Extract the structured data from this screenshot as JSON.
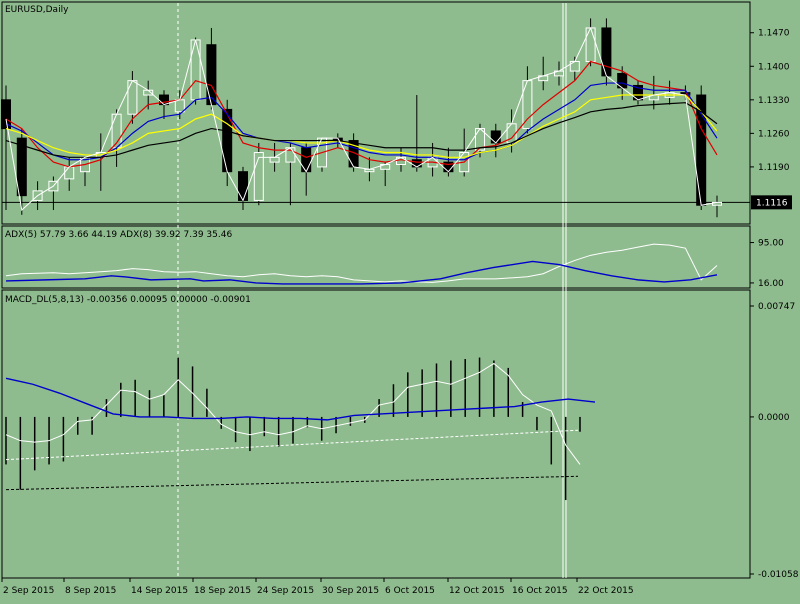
{
  "window": {
    "title": "EURUSD,Daily"
  },
  "colors": {
    "background": "#8fbc8f",
    "bull_body": "#8fbc8f",
    "bear_body": "#000000",
    "candle_outline": "#000000",
    "ma_red": "#e00000",
    "ma_blue": "#0000cc",
    "ma_yellow": "#ffff00",
    "ma_black": "#000000",
    "close_line": "#ffffff",
    "adx_line": "#ffffff",
    "di_line": "#0000cc",
    "macd_hist": "#000000",
    "macd_signal": "#0000cc",
    "macd_white": "#ffffff",
    "price_label_bg": "#000000",
    "price_label_text": "#ffffff"
  },
  "chart_data": [
    {
      "type": "candlestick",
      "title": "EURUSD,Daily",
      "yaxis_ticks": [
        "1.1470",
        "1.1400",
        "1.1330",
        "1.1260",
        "1.1190"
      ],
      "current_price": "1.1116",
      "x_ticks": [
        "2 Sep 2015",
        "8 Sep 2015",
        "14 Sep 2015",
        "18 Sep 2015",
        "24 Sep 2015",
        "30 Sep 2015",
        "6 Oct 2015",
        "12 Oct 2015",
        "16 Oct 2015",
        "22 Oct 2015"
      ],
      "ylim": [
        1.1075,
        1.153
      ],
      "candles": [
        {
          "o": 1.133,
          "h": 1.136,
          "l": 1.11,
          "c": 1.127
        },
        {
          "o": 1.125,
          "h": 1.127,
          "l": 1.109,
          "c": 1.113
        },
        {
          "o": 1.112,
          "h": 1.116,
          "l": 1.11,
          "c": 1.114
        },
        {
          "o": 1.114,
          "h": 1.117,
          "l": 1.11,
          "c": 1.116
        },
        {
          "o": 1.1165,
          "h": 1.121,
          "l": 1.114,
          "c": 1.119
        },
        {
          "o": 1.118,
          "h": 1.121,
          "l": 1.115,
          "c": 1.121
        },
        {
          "o": 1.121,
          "h": 1.126,
          "l": 1.114,
          "c": 1.122
        },
        {
          "o": 1.123,
          "h": 1.131,
          "l": 1.119,
          "c": 1.13
        },
        {
          "o": 1.13,
          "h": 1.139,
          "l": 1.128,
          "c": 1.137
        },
        {
          "o": 1.134,
          "h": 1.137,
          "l": 1.131,
          "c": 1.135
        },
        {
          "o": 1.134,
          "h": 1.135,
          "l": 1.129,
          "c": 1.132
        },
        {
          "o": 1.1305,
          "h": 1.135,
          "l": 1.129,
          "c": 1.133
        },
        {
          "o": 1.133,
          "h": 1.146,
          "l": 1.132,
          "c": 1.1455
        },
        {
          "o": 1.1445,
          "h": 1.148,
          "l": 1.131,
          "c": 1.132
        },
        {
          "o": 1.131,
          "h": 1.133,
          "l": 1.115,
          "c": 1.118
        },
        {
          "o": 1.118,
          "h": 1.119,
          "l": 1.11,
          "c": 1.112
        },
        {
          "o": 1.112,
          "h": 1.124,
          "l": 1.111,
          "c": 1.122
        },
        {
          "o": 1.12,
          "h": 1.124,
          "l": 1.118,
          "c": 1.121
        },
        {
          "o": 1.12,
          "h": 1.124,
          "l": 1.111,
          "c": 1.123
        },
        {
          "o": 1.123,
          "h": 1.124,
          "l": 1.113,
          "c": 1.118
        },
        {
          "o": 1.119,
          "h": 1.125,
          "l": 1.118,
          "c": 1.125
        },
        {
          "o": 1.125,
          "h": 1.126,
          "l": 1.123,
          "c": 1.1245
        },
        {
          "o": 1.1245,
          "h": 1.126,
          "l": 1.118,
          "c": 1.119
        },
        {
          "o": 1.118,
          "h": 1.121,
          "l": 1.116,
          "c": 1.1185
        },
        {
          "o": 1.1185,
          "h": 1.12,
          "l": 1.115,
          "c": 1.1195
        },
        {
          "o": 1.1195,
          "h": 1.123,
          "l": 1.118,
          "c": 1.121
        },
        {
          "o": 1.1205,
          "h": 1.134,
          "l": 1.118,
          "c": 1.119
        },
        {
          "o": 1.119,
          "h": 1.124,
          "l": 1.117,
          "c": 1.121
        },
        {
          "o": 1.12,
          "h": 1.123,
          "l": 1.117,
          "c": 1.118
        },
        {
          "o": 1.118,
          "h": 1.127,
          "l": 1.117,
          "c": 1.122
        },
        {
          "o": 1.1225,
          "h": 1.128,
          "l": 1.121,
          "c": 1.127
        },
        {
          "o": 1.1265,
          "h": 1.128,
          "l": 1.121,
          "c": 1.124
        },
        {
          "o": 1.124,
          "h": 1.131,
          "l": 1.122,
          "c": 1.128
        },
        {
          "o": 1.127,
          "h": 1.14,
          "l": 1.126,
          "c": 1.137
        },
        {
          "o": 1.137,
          "h": 1.142,
          "l": 1.135,
          "c": 1.138
        },
        {
          "o": 1.138,
          "h": 1.141,
          "l": 1.136,
          "c": 1.139
        },
        {
          "o": 1.139,
          "h": 1.142,
          "l": 1.137,
          "c": 1.141
        },
        {
          "o": 1.141,
          "h": 1.15,
          "l": 1.14,
          "c": 1.148
        },
        {
          "o": 1.148,
          "h": 1.15,
          "l": 1.136,
          "c": 1.138
        },
        {
          "o": 1.1385,
          "h": 1.14,
          "l": 1.133,
          "c": 1.1355
        },
        {
          "o": 1.136,
          "h": 1.137,
          "l": 1.132,
          "c": 1.133
        },
        {
          "o": 1.133,
          "h": 1.138,
          "l": 1.131,
          "c": 1.134
        },
        {
          "o": 1.1335,
          "h": 1.137,
          "l": 1.132,
          "c": 1.1345
        },
        {
          "o": 1.1345,
          "h": 1.136,
          "l": 1.133,
          "c": 1.134
        },
        {
          "o": 1.134,
          "h": 1.136,
          "l": 1.11,
          "c": 1.111
        },
        {
          "o": 1.111,
          "h": 1.113,
          "l": 1.1085,
          "c": 1.1116
        }
      ],
      "moving_averages": [
        {
          "color": "ma_red",
          "values": [
            1.129,
            1.127,
            1.123,
            1.12,
            1.119,
            1.1195,
            1.1205,
            1.124,
            1.129,
            1.132,
            1.1325,
            1.133,
            1.137,
            1.136,
            1.13,
            1.124,
            1.123,
            1.1225,
            1.1225,
            1.121,
            1.122,
            1.123,
            1.122,
            1.1205,
            1.12,
            1.1205,
            1.12,
            1.12,
            1.1195,
            1.12,
            1.123,
            1.1235,
            1.125,
            1.129,
            1.132,
            1.1345,
            1.137,
            1.141,
            1.14,
            1.139,
            1.137,
            1.136,
            1.1355,
            1.135,
            1.127,
            1.1215
          ]
        },
        {
          "color": "ma_blue",
          "values": [
            1.128,
            1.1265,
            1.124,
            1.1215,
            1.1205,
            1.1205,
            1.121,
            1.123,
            1.126,
            1.1285,
            1.1295,
            1.13,
            1.133,
            1.1335,
            1.13,
            1.126,
            1.125,
            1.1245,
            1.124,
            1.123,
            1.1235,
            1.124,
            1.123,
            1.122,
            1.1215,
            1.1215,
            1.121,
            1.121,
            1.1205,
            1.1205,
            1.122,
            1.1225,
            1.1235,
            1.1265,
            1.129,
            1.131,
            1.133,
            1.136,
            1.1365,
            1.1365,
            1.1355,
            1.135,
            1.135,
            1.135,
            1.13,
            1.125
          ]
        },
        {
          "color": "ma_yellow",
          "values": [
            1.127,
            1.126,
            1.1245,
            1.123,
            1.122,
            1.1215,
            1.1215,
            1.1225,
            1.124,
            1.126,
            1.1265,
            1.127,
            1.129,
            1.13,
            1.128,
            1.1255,
            1.125,
            1.1245,
            1.1245,
            1.124,
            1.124,
            1.1245,
            1.1235,
            1.1225,
            1.122,
            1.122,
            1.1215,
            1.1215,
            1.121,
            1.121,
            1.122,
            1.1225,
            1.1235,
            1.1255,
            1.1275,
            1.129,
            1.1305,
            1.133,
            1.1335,
            1.134,
            1.134,
            1.134,
            1.134,
            1.134,
            1.1305,
            1.1265
          ]
        },
        {
          "color": "ma_black",
          "values": [
            1.1245,
            1.1235,
            1.1225,
            1.1215,
            1.121,
            1.121,
            1.121,
            1.1215,
            1.1225,
            1.1235,
            1.124,
            1.1245,
            1.126,
            1.127,
            1.1265,
            1.1255,
            1.125,
            1.1245,
            1.1245,
            1.1245,
            1.1245,
            1.1245,
            1.124,
            1.1235,
            1.123,
            1.123,
            1.123,
            1.123,
            1.1225,
            1.1225,
            1.123,
            1.1232,
            1.124,
            1.1255,
            1.127,
            1.1282,
            1.1293,
            1.1305,
            1.131,
            1.1313,
            1.1318,
            1.132,
            1.1322,
            1.1324,
            1.1305,
            1.128
          ]
        }
      ],
      "close_line": [
        1.129,
        1.11,
        1.113,
        1.115,
        1.119,
        1.121,
        1.122,
        1.13,
        1.137,
        1.135,
        1.132,
        1.133,
        1.1455,
        1.132,
        1.118,
        1.112,
        1.121,
        1.121,
        1.123,
        1.118,
        1.125,
        1.125,
        1.119,
        1.1185,
        1.1195,
        1.121,
        1.119,
        1.121,
        1.118,
        1.122,
        1.127,
        1.124,
        1.128,
        1.137,
        1.138,
        1.139,
        1.141,
        1.148,
        1.138,
        1.1355,
        1.133,
        1.134,
        1.1345,
        1.134,
        1.111,
        1.1116
      ]
    },
    {
      "type": "line",
      "title": "ADX(5) 57.79 3.66 44.19 ADX(8) 39.92 7.39 35.46",
      "yaxis_ticks": [
        "95.00",
        "16.00"
      ],
      "ylim": [
        10,
        100
      ],
      "white_line": [
        30,
        34,
        35,
        36,
        34,
        36,
        38,
        40,
        44,
        42,
        38,
        37,
        38,
        34,
        30,
        28,
        32,
        34,
        30,
        28,
        30,
        28,
        22,
        20,
        18,
        20,
        18,
        17,
        20,
        24,
        24,
        24,
        26,
        28,
        34,
        48,
        60,
        70,
        76,
        80,
        86,
        92,
        90,
        84,
        22,
        50
      ],
      "white_line_points": 20,
      "blue_line": [
        [
          0,
          20
        ],
        [
          3,
          22
        ],
        [
          6,
          24
        ],
        [
          8,
          30
        ],
        [
          9,
          28
        ],
        [
          11,
          22
        ],
        [
          14,
          24
        ],
        [
          15,
          20
        ],
        [
          17,
          22
        ],
        [
          19,
          16
        ],
        [
          21,
          14
        ],
        [
          27,
          14
        ],
        [
          30,
          16
        ],
        [
          33,
          24
        ],
        [
          35,
          36
        ],
        [
          37,
          46
        ],
        [
          40,
          58
        ],
        [
          42,
          52
        ],
        [
          44,
          40
        ],
        [
          46,
          30
        ],
        [
          48,
          22
        ],
        [
          50,
          18
        ],
        [
          52,
          22
        ],
        [
          54,
          32
        ]
      ]
    },
    {
      "type": "bar",
      "title": "MACD_DL(5,8,13) -0.00356 0.00095 0.00000 -0.00901",
      "yaxis_ticks": [
        "0.00747",
        "0.0000",
        "-0.01058"
      ],
      "ylim": [
        -0.01058,
        0.00747
      ],
      "histogram": [
        -0.0032,
        -0.0049,
        -0.0036,
        -0.0032,
        -0.003,
        -0.0012,
        -0.0012,
        0.0012,
        0.0023,
        0.0025,
        0.0018,
        0.0015,
        0.004,
        0.0034,
        0.0019,
        -0.0008,
        -0.0017,
        -0.0023,
        -0.0013,
        -0.002,
        -0.0018,
        -0.0007,
        -0.0016,
        -0.0011,
        -0.0006,
        -0.0004,
        0.0012,
        0.0022,
        0.003,
        0.0032,
        0.0036,
        0.0038,
        0.0039,
        0.004,
        0.0038,
        0.0033,
        0.001,
        -0.0009,
        -0.0032,
        -0.0056,
        -0.001
      ],
      "white_line": [
        -0.0012,
        -0.0016,
        -0.0017,
        -0.0016,
        -0.0012,
        -0.0003,
        -0.0002,
        0.0008,
        0.0018,
        0.0017,
        0.0012,
        0.0015,
        0.0025,
        0.0016,
        0.0006,
        -0.0005,
        -0.001,
        -0.0012,
        -0.001,
        -0.0012,
        -0.001,
        -0.0006,
        -0.0008,
        -0.0006,
        -0.0004,
        -0.0002,
        0.0008,
        0.001,
        0.002,
        0.0022,
        0.0024,
        0.0022,
        0.0026,
        0.003,
        0.0036,
        0.0028,
        0.0015,
        0.0008,
        0.0004,
        -0.0019,
        -0.0032
      ],
      "signal_line": [
        0.0026,
        0.0022,
        0.0016,
        0.0009,
        0.0002,
        0.0,
        0.0,
        -0.0001,
        -0.0001,
        0.0,
        -0.0001,
        -0.0001,
        -0.0002,
        0.0001,
        0.0002,
        0.0003,
        0.0004,
        0.0005,
        0.0006,
        0.0007,
        0.001,
        0.0012,
        0.001
      ]
    }
  ]
}
